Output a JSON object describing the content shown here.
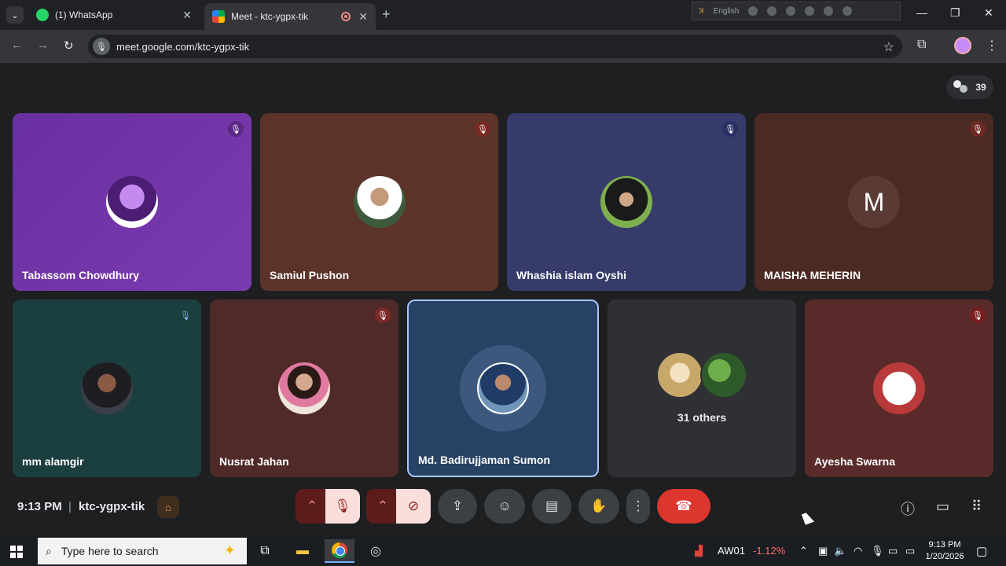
{
  "browser": {
    "tabs": [
      {
        "title": "(1) WhatsApp",
        "favicon": "whatsapp-icon",
        "color": "#25d366"
      },
      {
        "title": "Meet - ktc-ygpx-tik",
        "favicon": "google-meet-icon",
        "color": "#00ac47"
      }
    ],
    "url": "meet.google.com/ktc-ygpx-tik",
    "language_indicator": "English"
  },
  "meet": {
    "participant_count": "39",
    "participants": [
      {
        "name": "Tabassom Chowdhury",
        "muted": true
      },
      {
        "name": "Samiul Pushon",
        "muted": true
      },
      {
        "name": "Whashia islam Oyshi",
        "muted": true
      },
      {
        "name": "MAISHA MEHERIN",
        "muted": true,
        "initial": "M"
      },
      {
        "name": "mm alamgir",
        "muted": true
      },
      {
        "name": "Nusrat Jahan",
        "muted": true
      },
      {
        "name": "Md. Badirujjaman Sumon",
        "muted": false,
        "speaking": true
      },
      {
        "name": "Ayesha Swarna",
        "muted": true
      }
    ],
    "others_label": "31 others",
    "time": "9:13 PM",
    "separator": "|",
    "meeting_code": "ktc-ygpx-tik"
  },
  "taskbar": {
    "search_placeholder": "Type here to search",
    "stock_symbol": "AW01",
    "stock_change": "-1.12%",
    "clock_time": "9:13 PM",
    "clock_date": "1/20/2026"
  },
  "colors": {
    "hangup": "#dc362e",
    "active_speaker_border": "#a8c7fa"
  }
}
